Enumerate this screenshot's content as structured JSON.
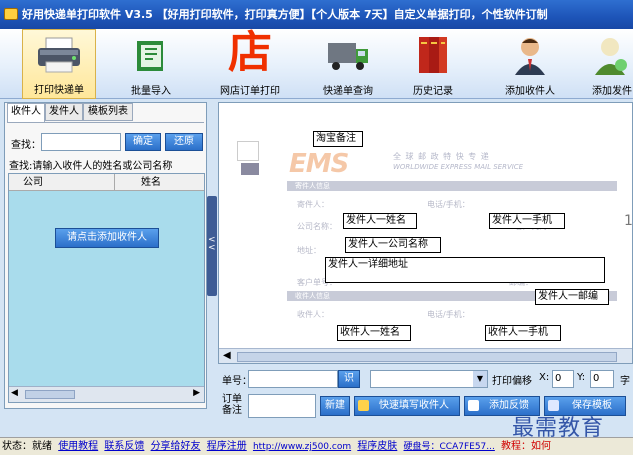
{
  "window": {
    "title": "好用快递单打印软件 V3.5 【好用打印软件，打印真方便】【个人版本  7天】自定义单据打印，个性软件订制"
  },
  "toolbar": {
    "items": [
      {
        "label": "打印快递单",
        "icon": "printer-icon"
      },
      {
        "label": "批量导入",
        "icon": "import-icon"
      },
      {
        "label": "网店订单打印",
        "icon": "shop-icon"
      },
      {
        "label": "快递单查询",
        "icon": "truck-icon"
      },
      {
        "label": "历史记录",
        "icon": "books-icon"
      },
      {
        "label": "添加收件人",
        "icon": "person-icon"
      },
      {
        "label": "添加发件",
        "icon": "person-add-icon"
      }
    ]
  },
  "left_panel": {
    "tabs": [
      "收件人",
      "发件人",
      "模板列表"
    ],
    "find_label": "查找：",
    "find_value": "",
    "confirm_label": "确定",
    "restore_label": "还原",
    "hint": "查找:请输入收件人的姓名或公司名称",
    "columns": [
      "公司",
      "姓名"
    ],
    "add_button": "请点击添加收件人"
  },
  "preview": {
    "taobao_note": "淘宝备注",
    "ems_logo": "EMS",
    "ems_cn": "全 球 邮 政 特 快 专 递",
    "ems_en": "WORLDWIDE EXPRESS MAIL SERVICE",
    "sender_section": "寄件人信息",
    "sender_label": "寄件人：",
    "sender_name": "发件人一姓名",
    "phone_label": "电话/手机：",
    "sender_phone": "发件人一手机",
    "company_label": "公司名称：",
    "sender_company": "发件人一公司名称",
    "customer_code_label": "客户代码：",
    "address_label": "地址：",
    "sender_address": "发件人一详细地址",
    "customer_no_label": "客户单号：",
    "postcode_label": "邮编：",
    "sender_postcode": "发件人一邮编",
    "receiver_section": "收件人信息",
    "receiver_label": "收件人：",
    "receiver_name": "收件人一姓名",
    "receiver_phone_label": "电话/手机：",
    "receiver_phone": "收件人一手机",
    "edge_digit": "1"
  },
  "bottom": {
    "order_label": "单号：",
    "order_value": "",
    "id_button": "识",
    "offset_label": "打印偏移",
    "x_label": "X:",
    "x_value": "0",
    "y_label": "Y:",
    "y_value": "0",
    "font_label": "字",
    "note_label": "订单\n备注",
    "new_button": "新建",
    "quick_fill_button": "快速填写收件人",
    "add_feedback_button": "添加反馈",
    "save_template_button": "保存模板"
  },
  "statusbar": {
    "state": "状态：就绪",
    "tutorial": "使用教程",
    "contact": "联系反馈",
    "share": "分享给好友",
    "register": "程序注册",
    "url": "http://www.zj500.com",
    "skin": "程序皮肤",
    "disk": "硬盘号：CCA7FE57...",
    "teach": "教程：如何"
  },
  "watermark": "最需教育"
}
